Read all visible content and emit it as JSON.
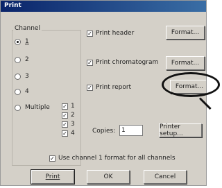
{
  "window": {
    "title": "Print"
  },
  "channel_group": {
    "legend": "Channel",
    "options": [
      "1",
      "2",
      "3",
      "4"
    ],
    "multiple_label": "Multiple",
    "multiple_channels": [
      "1",
      "2",
      "3",
      "4"
    ]
  },
  "print_options": {
    "header_label": "Print header",
    "chromatogram_label": "Print chromatogram",
    "report_label": "Print report",
    "format_label": "Format..."
  },
  "copies": {
    "label": "Copies:",
    "value": "1"
  },
  "printer_setup_label": "Printer setup...",
  "use_channel_label": "Use channel 1 format for all channels",
  "buttons": {
    "print": "Print",
    "ok": "OK",
    "cancel": "Cancel"
  }
}
